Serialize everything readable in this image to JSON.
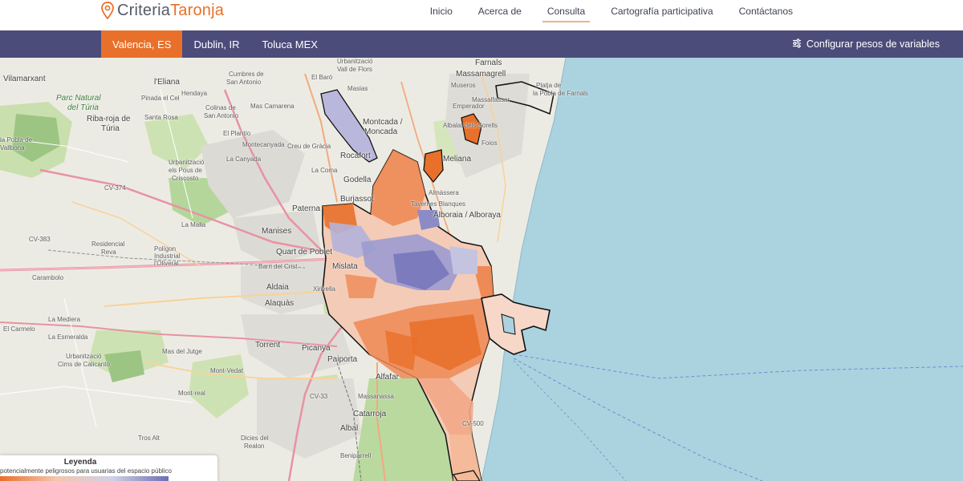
{
  "brand": {
    "part1": "Criteria",
    "part2": "Taronja",
    "accent_color": "#e8702a",
    "icon": "map-pin-icon"
  },
  "nav": {
    "items": [
      {
        "label": "Inicio"
      },
      {
        "label": "Acerca de"
      },
      {
        "label": "Consulta"
      },
      {
        "label": "Cartografía participativa"
      },
      {
        "label": "Contáctanos"
      }
    ],
    "active": "Consulta"
  },
  "citybar": {
    "background": "#4b4c7a",
    "cities": [
      {
        "label": "Valencia, ES"
      },
      {
        "label": "Dublin, IR"
      },
      {
        "label": "Toluca MEX"
      }
    ],
    "active": "Valencia, ES",
    "config_label": "Configurar pesos de variables",
    "config_icon": "sliders-icon"
  },
  "map": {
    "labels": {
      "vilamarxant": "Vilamarxant",
      "eliana": "l'Eliana",
      "parc1": "Parc Natural",
      "parc2": "del Túria",
      "riba1": "Riba-roja de",
      "riba2": "Túria",
      "pobla1": "la Pobla de",
      "pobla2": "Vallbona",
      "pineda": "Pinada el Cel",
      "santarosa": "Santa Rosa",
      "hendaya": "Hendaya",
      "urbflors1": "Urbanització",
      "urbflors2": "Vall de Flors",
      "cumbres1": "Cumbres de",
      "cumbres2": "San Antonio",
      "masias": "Masias",
      "elbaro": "El Baró",
      "massarrojos": "Mas Camarena",
      "colinas1": "Colinas de",
      "colinas2": "San Antonio",
      "elplantio": "El Plantío",
      "montcada1": "Montcada /",
      "montcada2": "Moncada",
      "montecanyada": "Montecanyada",
      "creu": "Creu de Gràcia",
      "lacanyada": "La Canyada",
      "rocafort": "Rocafort",
      "lacoma": "La Coma",
      "godella": "Godella",
      "burjassot": "Burjassot",
      "paterna": "Paterna",
      "urbpous1": "Urbanització",
      "urbpous2": "els Pous de",
      "urbpous3": "Criscosto",
      "lamalla": "La Malla",
      "manises": "Manises",
      "quart": "Quart de Poblet",
      "barri": "Barri del Crist",
      "mislata": "Mislata",
      "aldaia": "Aldaia",
      "xirivella": "Xirivella",
      "alaquas": "Alaquàs",
      "residencial1": "Residencial",
      "residencial2": "Reva",
      "poligon1": "Polígon",
      "poligon2": "Industrial",
      "poligon3": "l'Oliveral",
      "carambolo": "Carambolo",
      "lamediera": "La Mediera",
      "carmelo": "El Carmelo",
      "esmeralda": "La Esmeralda",
      "urbcims1": "Urbanització",
      "urbcims2": "Cims de Calicanto",
      "masdeljutge": "Mas del Jutge",
      "torrent": "Torrent",
      "picanya": "Picanya",
      "paiporta": "Paiporta",
      "montvedat": "Mont-Vedat",
      "montreal": "Mont-real",
      "trosalt": "Tros Alt",
      "dicies1": "Dicies del",
      "dicies2": "Realon",
      "alfafar": "Alfafar",
      "massanassa": "Massanassa",
      "catarroja": "Catarroja",
      "albal": "Albal",
      "beniparrell": "Beniparrell",
      "farnals": "Farnals",
      "massamagrell": "Massamagrell",
      "museros": "Museros",
      "massalfassar": "Massalfassar",
      "emperador": "Emperador",
      "albalat": "Albalat dels Sorells",
      "meliana": "Meliana",
      "foios": "Foios",
      "almassera": "Almàssera",
      "tavernes": "Tavernes Blanques",
      "alboraya": "Alboraia / Alboraya",
      "platja1": "Platja de",
      "platja2": "la Pobla de Farnals",
      "cv374": "CV-374",
      "cv383": "CV-383",
      "cv33": "CV-33",
      "cv500": "CV-500"
    }
  },
  "legend": {
    "title": "Leyenda",
    "description": "potencialmente peligrosos para usuarias del espacio público",
    "gradient_colors": [
      "#e8702a",
      "#f3c7ad",
      "#cfd0e6",
      "#6e6eb4"
    ]
  }
}
